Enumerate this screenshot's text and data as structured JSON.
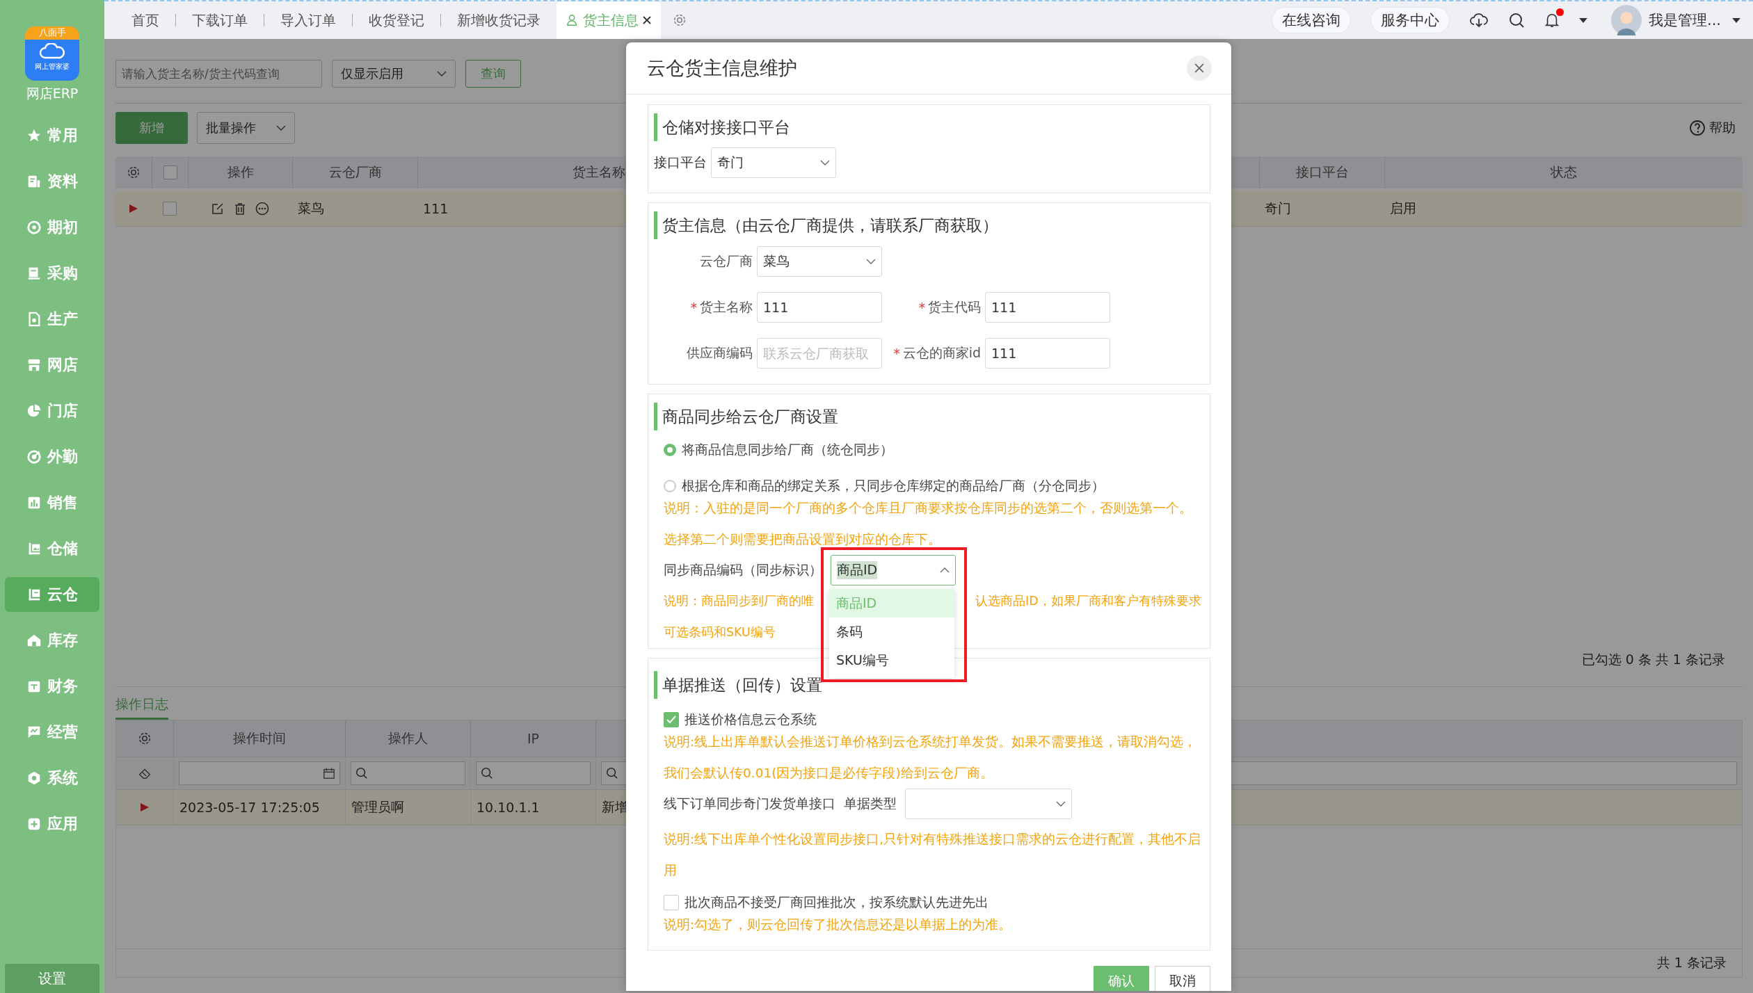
{
  "sidebar": {
    "logo_badge": "八面手",
    "logo_caption": "网上管家婆",
    "app_name": "网店ERP",
    "items": [
      {
        "label": "常用",
        "selected": false
      },
      {
        "label": "资料",
        "selected": false
      },
      {
        "label": "期初",
        "selected": false
      },
      {
        "label": "采购",
        "selected": false
      },
      {
        "label": "生产",
        "selected": false
      },
      {
        "label": "网店",
        "selected": false
      },
      {
        "label": "门店",
        "selected": false
      },
      {
        "label": "外勤",
        "selected": false
      },
      {
        "label": "销售",
        "selected": false
      },
      {
        "label": "仓储",
        "selected": false
      },
      {
        "label": "云仓",
        "selected": true
      },
      {
        "label": "库存",
        "selected": false
      },
      {
        "label": "财务",
        "selected": false
      },
      {
        "label": "经营",
        "selected": false
      },
      {
        "label": "系统",
        "selected": false
      },
      {
        "label": "应用",
        "selected": false
      }
    ],
    "settings": "设置"
  },
  "tabs": [
    {
      "label": "首页",
      "selected": false,
      "closable": false
    },
    {
      "label": "下载订单",
      "selected": false,
      "closable": false
    },
    {
      "label": "导入订单",
      "selected": false,
      "closable": false
    },
    {
      "label": "收货登记",
      "selected": false,
      "closable": false
    },
    {
      "label": "新增收货记录",
      "selected": false,
      "closable": false
    },
    {
      "label": "货主信息",
      "selected": true,
      "closable": true
    }
  ],
  "header": {
    "links": [
      "在线咨询",
      "服务中心"
    ],
    "notification_dot": true,
    "user": "我是管理..."
  },
  "toolbar": {
    "search_placeholder": "请输入货主名称/货主代码查询",
    "filter": "仅显示启用",
    "query": "查询",
    "add": "新增",
    "batch": "批量操作",
    "help": "帮助"
  },
  "table": {
    "columns": [
      "操作",
      "云仓厂商",
      "货主名称",
      "接口平台",
      "状态"
    ],
    "rows": [
      {
        "vendor": "菜鸟",
        "owner_name": "111",
        "platform": "奇门",
        "status": "启用",
        "checked": false,
        "current": true
      }
    ],
    "all_checked": false,
    "summary": "已勾选 0 条 共 1 条记录"
  },
  "log": {
    "tab": "操作日志",
    "columns": [
      "操作时间",
      "操作人",
      "IP"
    ],
    "rows": [
      {
        "time": "2023-05-17 17:25:05",
        "operator": "管理员啊",
        "ip": "10.10.1.1",
        "column_4": "新增",
        "current": true
      }
    ],
    "summary": "共 1 条记录"
  },
  "dialog": {
    "title": "云仓货主信息维护",
    "platform_section": {
      "heading": "仓储对接接口平台",
      "label": "接口平台",
      "value": "奇门"
    },
    "owner_section": {
      "heading": "货主信息（由云仓厂商提供，请联系厂商获取）",
      "required_mark": "*",
      "fields": [
        {
          "kind": "select",
          "label": "云仓厂商",
          "value": "菜鸟",
          "required": false
        },
        {
          "kind": "input",
          "label": "货主名称",
          "value": "111",
          "required": true
        },
        {
          "kind": "input",
          "label": "货主代码",
          "value": "111",
          "required": true
        },
        {
          "kind": "input",
          "label": "供应商编码",
          "placeholder": "联系云仓厂商获取",
          "required": false
        },
        {
          "kind": "input",
          "label": "云仓的商家id",
          "value": "111",
          "required": true
        }
      ]
    },
    "sync_section": {
      "heading": "商品同步给云仓厂商设置",
      "options": [
        {
          "label": "将商品信息同步给厂商（统仓同步）",
          "selected": true
        },
        {
          "label": "根据仓库和商品的绑定关系，只同步仓库绑定的商品给厂商（分仓同步）",
          "selected": false
        }
      ],
      "note": "说明：入驻的是同一个厂商的多个仓库且厂商要求按仓库同步的选第二个，否则选第一个。选择第二个则需要把商品设置到对应的仓库下。",
      "code_label": "同步商品编码（同步标识）",
      "code_value": "商品ID",
      "code_open": true,
      "code_options": [
        {
          "label": "商品ID",
          "selected": true
        },
        {
          "label": "条码",
          "selected": false
        },
        {
          "label": "SKU编号",
          "selected": false
        }
      ],
      "code_note_start": "说明：商品同步到厂商的唯",
      "code_note_end": "认选商品ID，如果厂商和客户有特殊要求",
      "code_note_line2": "可选条码和SKU编号"
    },
    "push_section": {
      "heading": "单据推送（回传）设置",
      "items": [
        {
          "kind": "checkbox",
          "label": "推送价格信息云仓系统",
          "checked": true
        },
        {
          "kind": "note",
          "text": "说明:线上出库单默认会推送订单价格到云仓系统打单发货。如果不需要推送，请取消勾选，我们会默认传0.01(因为接口是必传字段)给到云仓厂商。"
        },
        {
          "kind": "select",
          "label": "线下订单同步奇门发货单接口",
          "type_label": "单据类型"
        },
        {
          "kind": "note",
          "text": "说明:线下出库单个性化设置同步接口,只针对有特殊推送接口需求的云仓进行配置，其他不启用"
        },
        {
          "kind": "checkbox",
          "label": "批次商品不接受厂商回推批次，按系统默认先进先出",
          "checked": false
        },
        {
          "kind": "note",
          "text": "说明:勾选了，则云仓回传了批次信息还是以单据上的为准。"
        }
      ]
    },
    "confirm": "确认",
    "cancel": "取消"
  }
}
